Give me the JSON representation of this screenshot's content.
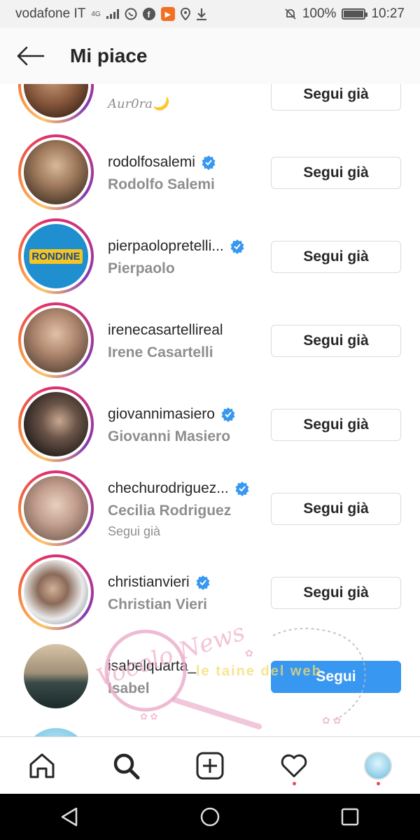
{
  "status_bar": {
    "carrier": "vodafone IT",
    "network": "4G",
    "battery": "100%",
    "time": "10:27"
  },
  "header": {
    "title": "Mi piace"
  },
  "rows": [
    {
      "username": "",
      "fullname": "Aur0ra🌙",
      "extra": "",
      "verified": false,
      "button": "Segui già"
    },
    {
      "username": "rodolfosalemi",
      "fullname": "Rodolfo Salemi",
      "extra": "",
      "verified": true,
      "button": "Segui già"
    },
    {
      "username": "pierpaolopretelli...",
      "fullname": "Pierpaolo",
      "extra": "",
      "verified": true,
      "button": "Segui già"
    },
    {
      "username": "irenecasartellireal",
      "fullname": "Irene Casartelli",
      "extra": "",
      "verified": false,
      "button": "Segui già"
    },
    {
      "username": "giovannimasiero",
      "fullname": "Giovanni Masiero",
      "extra": "",
      "verified": true,
      "button": "Segui già"
    },
    {
      "username": "chechurodriguez...",
      "fullname": "Cecilia Rodriguez",
      "extra": "Segui già",
      "verified": true,
      "button": "Segui già"
    },
    {
      "username": "christianvieri",
      "fullname": "Christian Vieri",
      "extra": "",
      "verified": true,
      "button": "Segui già"
    },
    {
      "username": "isabelquarta_",
      "fullname": "Isabel",
      "extra": "",
      "verified": false,
      "button": "Segui"
    }
  ],
  "avatar_logo_text": "RONDINE",
  "watermark": {
    "left_text": "Vocolo News",
    "right_text": "le taine del web"
  },
  "icons": {
    "back": "arrow-left-icon",
    "verified": "verified-badge-icon",
    "home": "home-icon",
    "search": "search-icon",
    "add": "add-post-icon",
    "heart": "heart-icon",
    "profile": "profile-avatar-icon"
  },
  "colors": {
    "primary_button": "#3897f0",
    "verified": "#3897f0",
    "notification_dot": "#ed4956"
  }
}
